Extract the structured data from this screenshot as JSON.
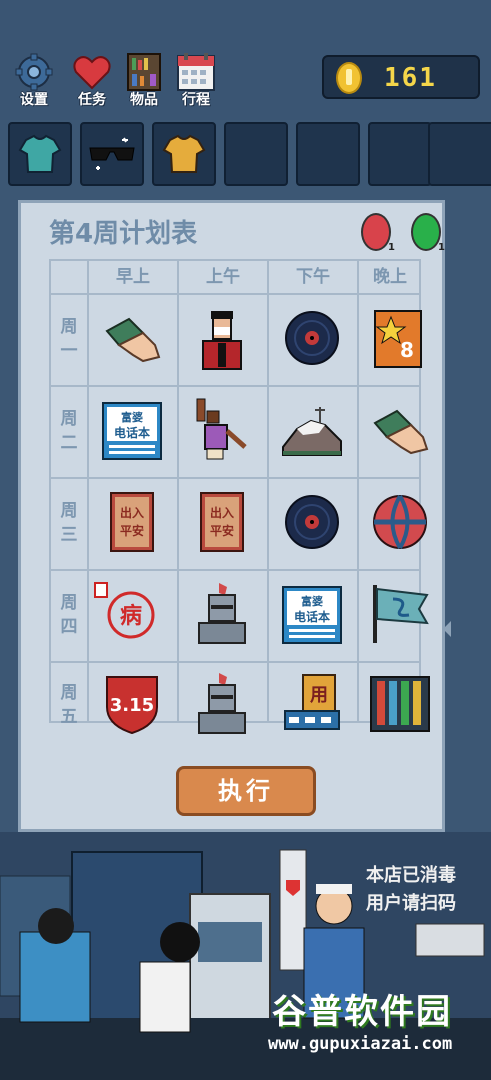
{
  "menu": {
    "settings": "设置",
    "tasks": "任务",
    "items": "物品",
    "schedule": "行程"
  },
  "coins": "161",
  "plan": {
    "title": "第4周计划表",
    "badges": [
      {
        "color": "#d8434b",
        "count": "1"
      },
      {
        "color": "#29b04a",
        "count": "1"
      }
    ],
    "columns": [
      "早上",
      "上午",
      "下午",
      "晚上"
    ],
    "rows": [
      {
        "label": "周一",
        "cells": [
          "eraser-hand",
          "masked-person",
          "vinyl-record",
          "star-poster"
        ]
      },
      {
        "label": "周二",
        "cells": [
          "phone-book",
          "dancing-person",
          "hill-house",
          "eraser-hand"
        ]
      },
      {
        "label": "周三",
        "cells": [
          "charm-amulet",
          "charm-amulet",
          "vinyl-record",
          "basketball"
        ]
      },
      {
        "label": "周四",
        "cells": [
          "sick-stamp",
          "knight-helmet",
          "phone-book",
          "flag"
        ]
      },
      {
        "label": "周五",
        "cells": [
          "315-shield",
          "knight-helmet",
          "stand-sign",
          "test-tubes"
        ]
      }
    ],
    "phone_book_text": [
      "富婆",
      "电话本"
    ],
    "charm_text": [
      "出入",
      "平安"
    ],
    "sick_text": "病",
    "shield_text": "3.15",
    "star_text": "8",
    "stand_text": "用"
  },
  "execute_label": "执行",
  "scene": {
    "sign_lines": [
      "本店已消毒",
      "用户请扫码"
    ]
  },
  "watermark": {
    "title": "谷普软件园",
    "url": "www.gupuxiazai.com"
  }
}
